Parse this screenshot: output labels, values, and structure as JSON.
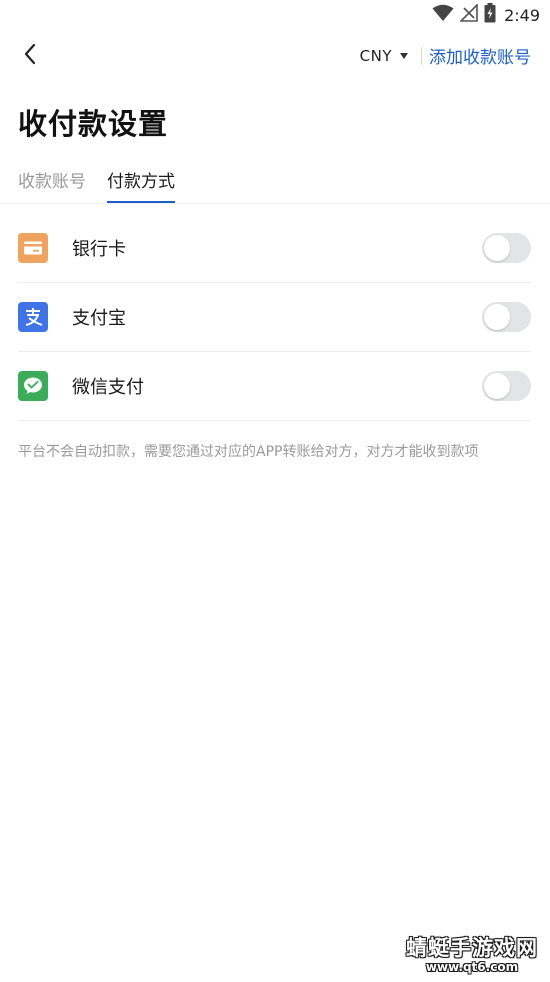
{
  "status_bar": {
    "time": "2:49",
    "icons": [
      "wifi-icon",
      "no-signal-icon",
      "battery-charging-icon"
    ]
  },
  "header": {
    "back_icon": "back-chevron-icon",
    "currency": "CNY",
    "add_account_label": "添加收款账号"
  },
  "page": {
    "title": "收付款设置"
  },
  "tabs": [
    {
      "label": "收款账号",
      "active": false
    },
    {
      "label": "付款方式",
      "active": true
    }
  ],
  "payment_methods": [
    {
      "label": "银行卡",
      "icon": "bank-card-icon",
      "color": "#f0a35e",
      "enabled": false
    },
    {
      "label": "支付宝",
      "icon": "alipay-icon",
      "color": "#3f73e6",
      "enabled": false
    },
    {
      "label": "微信支付",
      "icon": "wechat-pay-icon",
      "color": "#3cac5a",
      "enabled": false
    }
  ],
  "notice": "平台不会自动扣款，需要您通过对应的APP转账给对方，对方才能收到款项",
  "watermark": {
    "title": "蜻蜓手游戏网",
    "url": "www.qt6.com"
  },
  "colors": {
    "accent": "#1e5fc6",
    "toggle_off": "#e2e4e8"
  }
}
